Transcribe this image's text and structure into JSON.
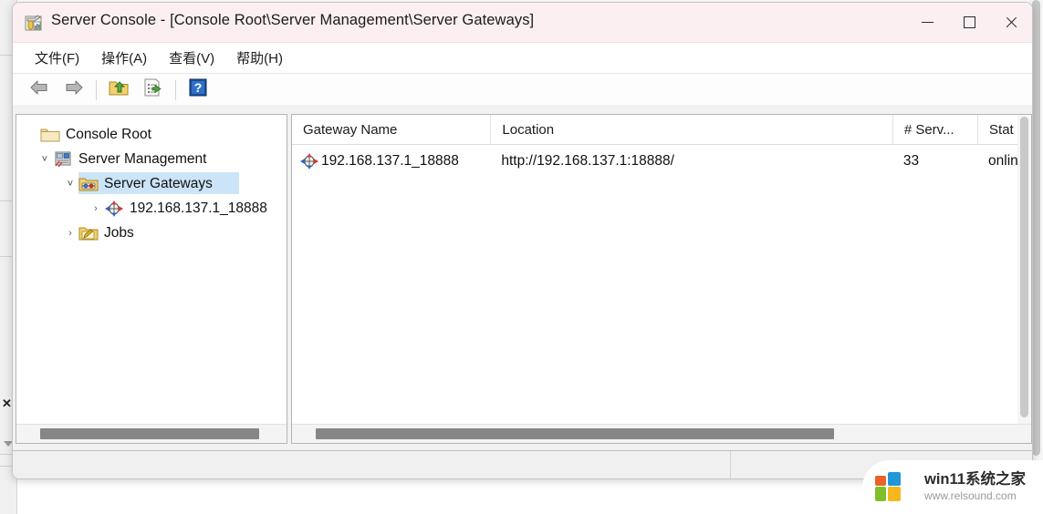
{
  "window": {
    "title": "Server Console - [Console Root\\Server Management\\Server Gateways]",
    "icon": "mmc-console-icon",
    "controls": {
      "minimize": "Minimize",
      "maximize": "Maximize",
      "close": "Close"
    }
  },
  "menubar": {
    "items": [
      {
        "label": "文件(F)",
        "name": "menu-file"
      },
      {
        "label": "操作(A)",
        "name": "menu-action"
      },
      {
        "label": "查看(V)",
        "name": "menu-view"
      },
      {
        "label": "帮助(H)",
        "name": "menu-help"
      }
    ]
  },
  "toolbar": {
    "buttons": [
      {
        "name": "back-arrow-icon",
        "label": "Back"
      },
      {
        "name": "forward-arrow-icon",
        "label": "Forward"
      },
      {
        "name": "up-folder-icon",
        "label": "Up One Level"
      },
      {
        "name": "export-list-icon",
        "label": "Export List"
      },
      {
        "name": "help-icon",
        "label": "Help"
      }
    ]
  },
  "tree": {
    "nodes": [
      {
        "label": "Console Root",
        "icon": "folder-icon",
        "indent": 0,
        "chevron": "",
        "selected": false
      },
      {
        "label": "Server Management",
        "icon": "server-management-icon",
        "indent": 1,
        "chevron": "expanded",
        "selected": false
      },
      {
        "label": "Server Gateways",
        "icon": "gateway-folder-icon",
        "indent": 2,
        "chevron": "expanded",
        "selected": true
      },
      {
        "label": "192.168.137.1_18888",
        "icon": "gateway-node-icon",
        "indent": 3,
        "chevron": "collapsed",
        "selected": false
      },
      {
        "label": "Jobs",
        "icon": "jobs-folder-icon",
        "indent": 2,
        "chevron": "collapsed",
        "selected": false
      }
    ]
  },
  "listview": {
    "columns": [
      {
        "label": "Gateway Name",
        "name": "column-gateway-name"
      },
      {
        "label": "Location",
        "name": "column-location"
      },
      {
        "label": "# Serv...",
        "name": "column-server-count"
      },
      {
        "label": "Stat",
        "name": "column-status"
      }
    ],
    "rows": [
      {
        "icon": "gateway-node-icon",
        "gateway_name": "192.168.137.1_18888",
        "location": "http://192.168.137.1:18888/",
        "server_count": "33",
        "status": "onlin"
      }
    ]
  },
  "statusbar": {
    "left_text": "",
    "right_text": ""
  },
  "watermark": {
    "title": "win11系统之家",
    "url": "www.relsound.com",
    "logo_colors": [
      "#e8622a",
      "#2196d8",
      "#7fbf2a",
      "#f5b81c"
    ]
  },
  "colors": {
    "titlebar_bg": "#fbeff2",
    "selection": "#cce4f7",
    "pane_border": "#b5b5b5",
    "scrollbar_thumb": "#868686"
  }
}
